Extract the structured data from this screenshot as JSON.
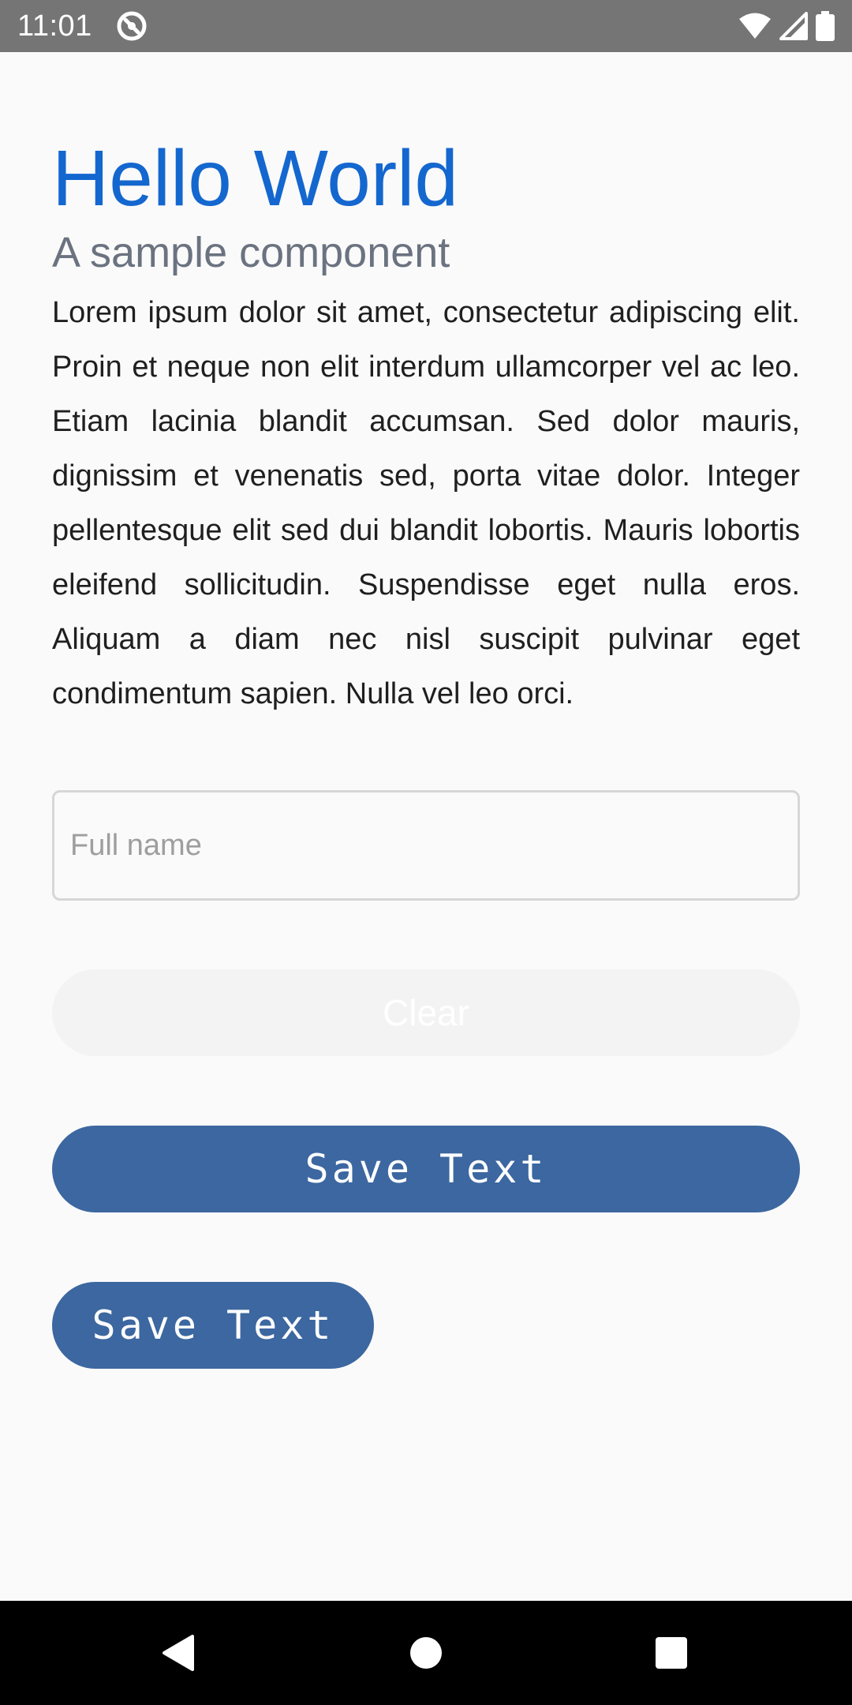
{
  "status_bar": {
    "time": "11:01",
    "icons": [
      "sync-badge-icon",
      "wifi-icon",
      "signal-icon",
      "battery-icon"
    ]
  },
  "header": {
    "title": "Hello World",
    "subtitle": "A sample component"
  },
  "body": {
    "paragraph": "Lorem ipsum dolor sit amet, consectetur adipiscing elit. Proin et neque non elit interdum ullamcorper vel ac leo. Etiam lacinia blandit accumsan. Sed dolor mauris, dignissim et venenatis sed, porta vitae dolor. Integer pellentesque elit sed dui blandit lobortis. Mauris lobortis eleifend sollicitudin. Suspendisse eget nulla eros. Aliquam a diam nec nisl suscipit pulvinar eget condimentum sapien. Nulla vel leo orci."
  },
  "form": {
    "name_placeholder": "Full name",
    "name_value": "",
    "clear_label": "Clear",
    "save_label": "Save Text",
    "save_compact_label": "Save Text"
  },
  "nav_bar": {
    "icons": [
      "back-icon",
      "home-icon",
      "recents-icon"
    ]
  },
  "colors": {
    "status_bar": "#757575",
    "title": "#1467cf",
    "subtitle": "#6b7280",
    "button": "#3c67a0",
    "disabled_button": "#f3f3f3",
    "nav_bar": "#000000",
    "background": "#fafafa"
  }
}
